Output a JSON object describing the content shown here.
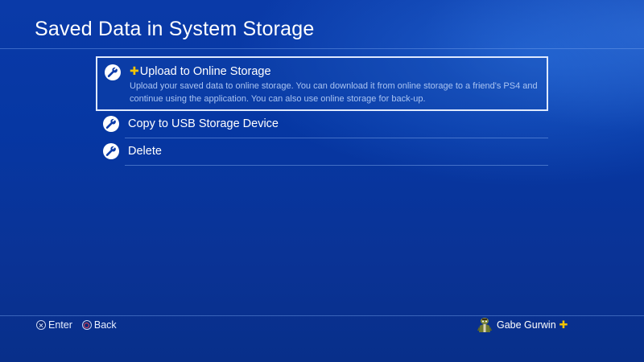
{
  "header": {
    "title": "Saved Data in System Storage"
  },
  "menu": {
    "items": [
      {
        "label": "Upload to Online Storage",
        "plus_prefix": "✚",
        "description": "Upload your saved data to online storage. You can download it from online storage to a friend's PS4 and continue using the application. You can also use online storage for back-up.",
        "icon": "wrench-icon",
        "selected": true
      },
      {
        "label": "Copy to USB Storage Device",
        "icon": "wrench-icon",
        "selected": false
      },
      {
        "label": "Delete",
        "icon": "wrench-icon",
        "selected": false
      }
    ]
  },
  "footer": {
    "enter_label": "Enter",
    "back_label": "Back",
    "enter_icon": "cross-button-icon",
    "back_icon": "circle-button-icon"
  },
  "user": {
    "name": "Gabe Gurwin",
    "plus_badge": "✚",
    "avatar_icon": "avatar-icon"
  },
  "colors": {
    "background": "#0637a3",
    "plus_yellow": "#f3c400",
    "description_text": "#aac4f2",
    "selection_border": "#dfe9ff"
  }
}
